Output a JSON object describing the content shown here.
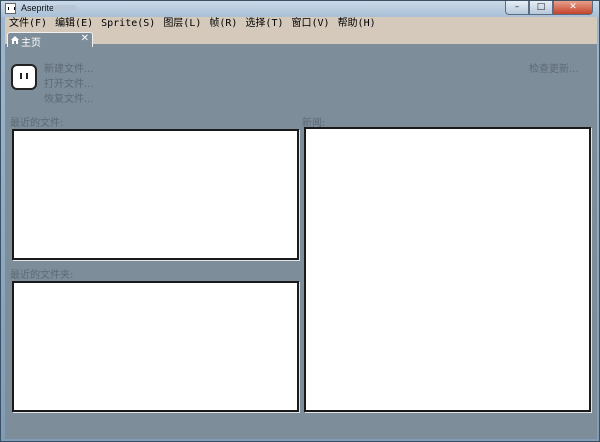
{
  "window": {
    "title": "Aseprite",
    "buttons": {
      "minimize": "–",
      "maximize": "□",
      "close": "✕"
    }
  },
  "menubar": {
    "items": [
      {
        "label": "文件(F)"
      },
      {
        "label": "编辑(E)"
      },
      {
        "label": "Sprite(S)"
      },
      {
        "label": "图层(L)"
      },
      {
        "label": "帧(R)"
      },
      {
        "label": "选择(T)"
      },
      {
        "label": "窗口(V)"
      },
      {
        "label": "帮助(H)"
      }
    ]
  },
  "tabs": [
    {
      "label": "主页",
      "icon": "home-icon",
      "close": "✕"
    }
  ],
  "home": {
    "actions": {
      "new_file": "新建文件...",
      "open_file": "打开文件...",
      "recover_files": "恢复文件..."
    },
    "check_updates": "检查更新...",
    "recent_files_label": "最近的文件:",
    "recent_folders_label": "最近的文件夹:",
    "news_label": "新闻:"
  },
  "colors": {
    "background": "#7d8d9a",
    "menubar": "#d4c9bb",
    "link_text": "#5d6a75",
    "panel": "#ffffff"
  }
}
